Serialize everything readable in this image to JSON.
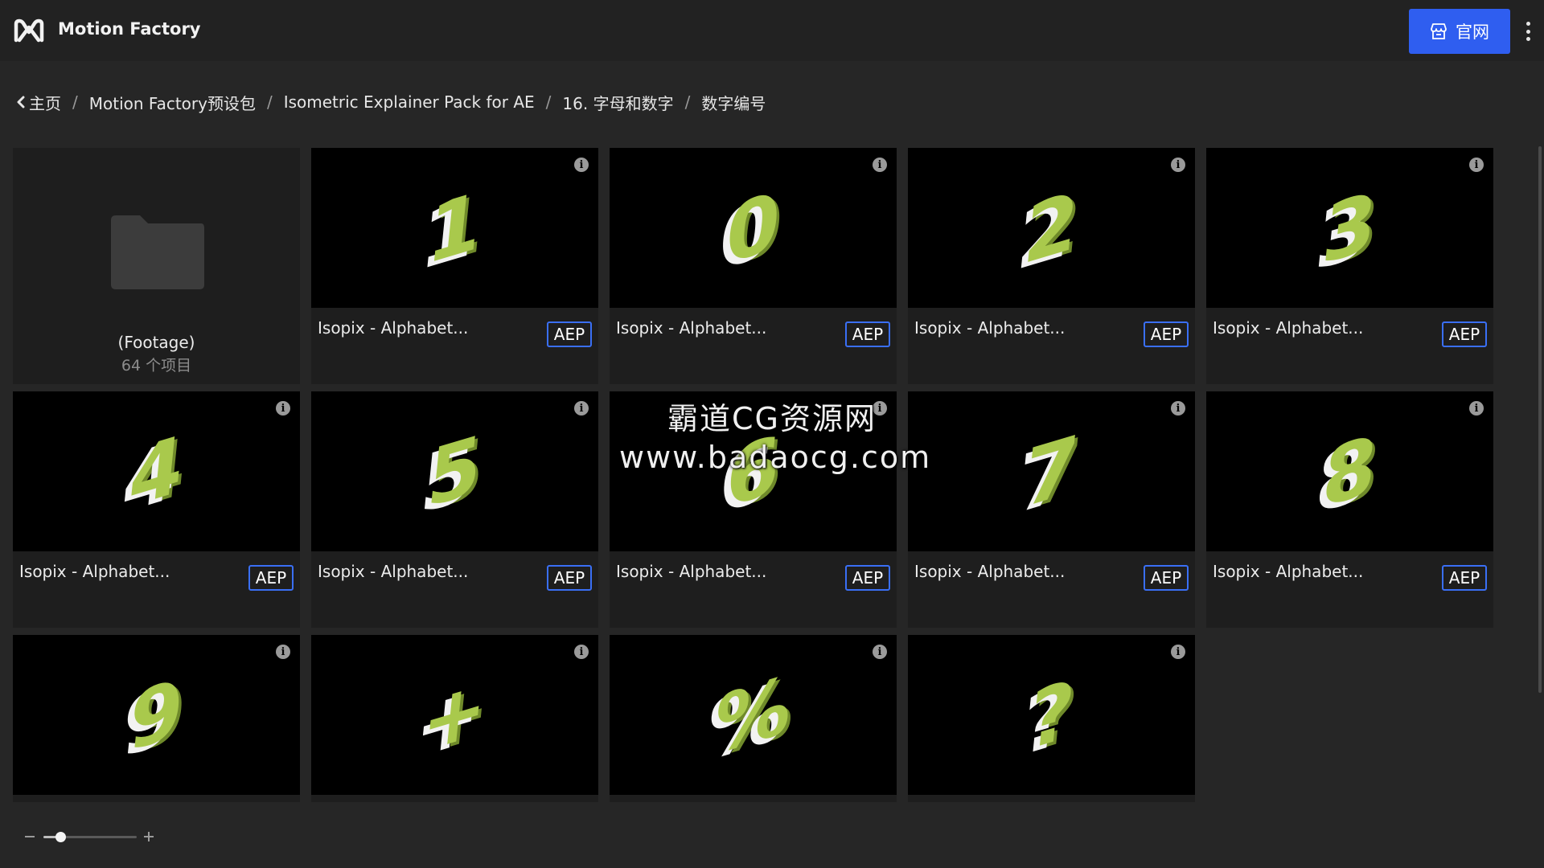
{
  "header": {
    "brand": "Motion Factory",
    "site_button_label": "官网"
  },
  "breadcrumb": {
    "items": [
      "主页",
      "Motion Factory预设包",
      "Isometric Explainer Pack for AE",
      "16. 字母和数字",
      "数字编号"
    ],
    "separator": "/"
  },
  "folder": {
    "name": "(Footage)",
    "count": "64 个项目"
  },
  "cards": [
    {
      "glyph": "1",
      "title": "Isopix - Alphabet...",
      "tag": "AEP"
    },
    {
      "glyph": "0",
      "title": "Isopix - Alphabet...",
      "tag": "AEP"
    },
    {
      "glyph": "2",
      "title": "Isopix - Alphabet...",
      "tag": "AEP"
    },
    {
      "glyph": "3",
      "title": "Isopix - Alphabet...",
      "tag": "AEP"
    },
    {
      "glyph": "4",
      "title": "Isopix - Alphabet...",
      "tag": "AEP"
    },
    {
      "glyph": "5",
      "title": "Isopix - Alphabet...",
      "tag": "AEP"
    },
    {
      "glyph": "6",
      "title": "Isopix - Alphabet...",
      "tag": "AEP"
    },
    {
      "glyph": "7",
      "title": "Isopix - Alphabet...",
      "tag": "AEP"
    },
    {
      "glyph": "8",
      "title": "Isopix - Alphabet...",
      "tag": "AEP"
    },
    {
      "glyph": "9",
      "title": "",
      "tag": ""
    },
    {
      "glyph": "+",
      "title": "",
      "tag": ""
    },
    {
      "glyph": "%",
      "title": "",
      "tag": ""
    },
    {
      "glyph": "?",
      "title": "",
      "tag": ""
    }
  ],
  "info_icon_glyph": "i",
  "watermark": {
    "line1": "霸道CG资源网",
    "line2": "www.badaocg.com"
  },
  "zoom": {
    "level_fraction": 0.18
  },
  "colors": {
    "accent": "#2f5ef0",
    "tag_border": "#3a6ff5",
    "glyph_green": "#a9c94c"
  },
  "icons": {
    "logo": "motion-factory-logo",
    "store": "store-icon",
    "back": "chevron-left-icon",
    "info": "info-icon",
    "folder": "folder-icon",
    "menu": "kebab-menu-icon"
  }
}
